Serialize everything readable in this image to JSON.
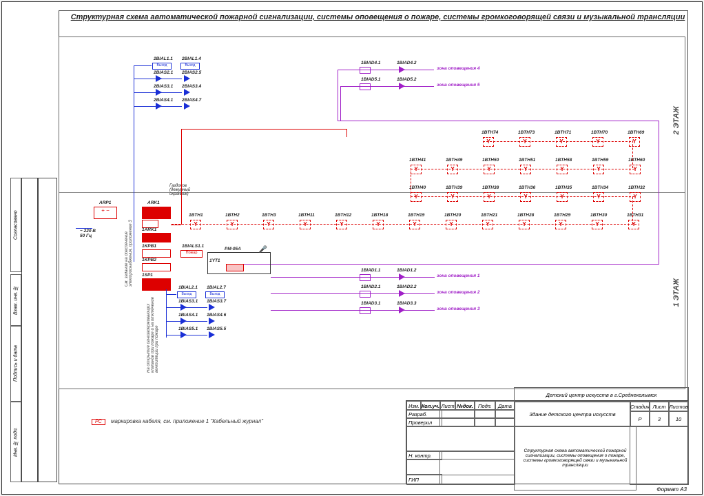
{
  "title": "Структурная схема автоматической пожарной сигнализации, системы оповещения о пожаре, системы громкоговорящей связи и музыкальной трансляции",
  "floor1_label": "1 ЭТАЖ",
  "floor2_label": "2 ЭТАЖ",
  "power_note": "~ 220 В\n50 Гц",
  "arp1": "ARP1",
  "ark1": "ARK1",
  "ark1_inner": "1ARK1",
  "krv1": "1KPB1",
  "krv2": "1KPB2",
  "sp1": "1SP1",
  "pm": "РМ-05А",
  "yt1": "1YT1",
  "bials11": "1BIALS1.1",
  "vyhod": "Выход",
  "pozar": "Пожар",
  "gosdokov": "Газдоков (дежурный охранник)",
  "vertical_note_left": "См. задание на обеспечение электроснабжения, приложение 3",
  "vertical_note_bottom": "На открытие огнезадерживающих клапанов при пожаре и на отключение вентиляции при пожаре",
  "zones": {
    "z1": "зона оповещения 1",
    "z2": "зона оповещения 2",
    "z3": "зона оповещения 3",
    "z4": "зона оповещения 4",
    "z5": "зона оповещения 5"
  },
  "biad_upper": {
    "r1": [
      "1BIAD4.1",
      "1BIAD4.2"
    ],
    "r2": [
      "1BIAD5.1",
      "1BIAD5.2"
    ]
  },
  "biad_lower": {
    "r1": [
      "1BIAD1.1",
      "1BIAD1.2"
    ],
    "r2": [
      "1BIAD2.1",
      "1BIAD2.2"
    ],
    "r3": [
      "1BIAD3.1",
      "1BIAD3.3"
    ]
  },
  "bials_upper": {
    "r1": [
      "2BIAL1.1",
      "2BIAL1.4"
    ],
    "r2": [
      "2BIAS2.1",
      "2BIAS2.5"
    ],
    "r3": [
      "2BIAS3.1",
      "2BIAS3.4"
    ],
    "r4": [
      "2BIAS4.1",
      "2BIAS4.7"
    ]
  },
  "bials_lower": {
    "r1": [
      "1BIAL2.1",
      "1BIAL2.7"
    ],
    "r2": [
      "1BIAS3.1",
      "1BIAS3.7"
    ],
    "r3": [
      "1BIAS4.1",
      "1BIAS4.6"
    ],
    "r4": [
      "1BIAS5.1",
      "1BIAS5.5"
    ]
  },
  "detector_rows": {
    "row1_top": [
      "1BTH74",
      "1BTH73",
      "1BTH71",
      "1BTH70",
      "1BTH69"
    ],
    "row2": [
      "1BTH41",
      "1BTH49",
      "1BTH50",
      "1BTH51",
      "1BTH58",
      "1BTH59",
      "1BTH60"
    ],
    "row3": [
      "1BTH40",
      "1BTH39",
      "1BTH38",
      "1BTH36",
      "1BTH35",
      "1BTH34",
      "1BTH32"
    ],
    "row4_main": [
      "1BTH1",
      "1BTH2",
      "1BTH3",
      "1BTH11",
      "1BTH12",
      "1BTH18",
      "1BTH19",
      "1BTH20",
      "1BTH21",
      "1BTH28",
      "1BTH29",
      "1BTH30",
      "1BTH31"
    ]
  },
  "note_text": "маркировка кабеля, см. приложение 1 \"Кабельный журнал\"",
  "note_prefix": "PC",
  "titleblock": {
    "project": "Детский центр искусств в г.Среднеколымск",
    "object": "Здание детского центра искусств",
    "sheet_title": "Структурная схема автоматической пожарной сигнализации, системы оповещения о пожаре, системы громкоговорящей связи и музыкальной трансляции",
    "headers": {
      "izm": "Изм.",
      "koluch": "Кол.уч.",
      "list": "Лист",
      "ndok": "№док.",
      "podp": "Подп.",
      "data": "Дата",
      "stadia": "Стадия",
      "list2": "Лист",
      "listov": "Листов",
      "razrab": "Разраб.",
      "proveril": "Проверил",
      "nkontr": "Н. контр.",
      "gip": "ГИП"
    },
    "values": {
      "stadia": "Р",
      "list": "3",
      "listov": "10"
    }
  },
  "format": "Формат А3",
  "side_labels": [
    "Инв. № подп.",
    "Подпись и дата",
    "Взам. инв. №",
    "Согласовано"
  ]
}
